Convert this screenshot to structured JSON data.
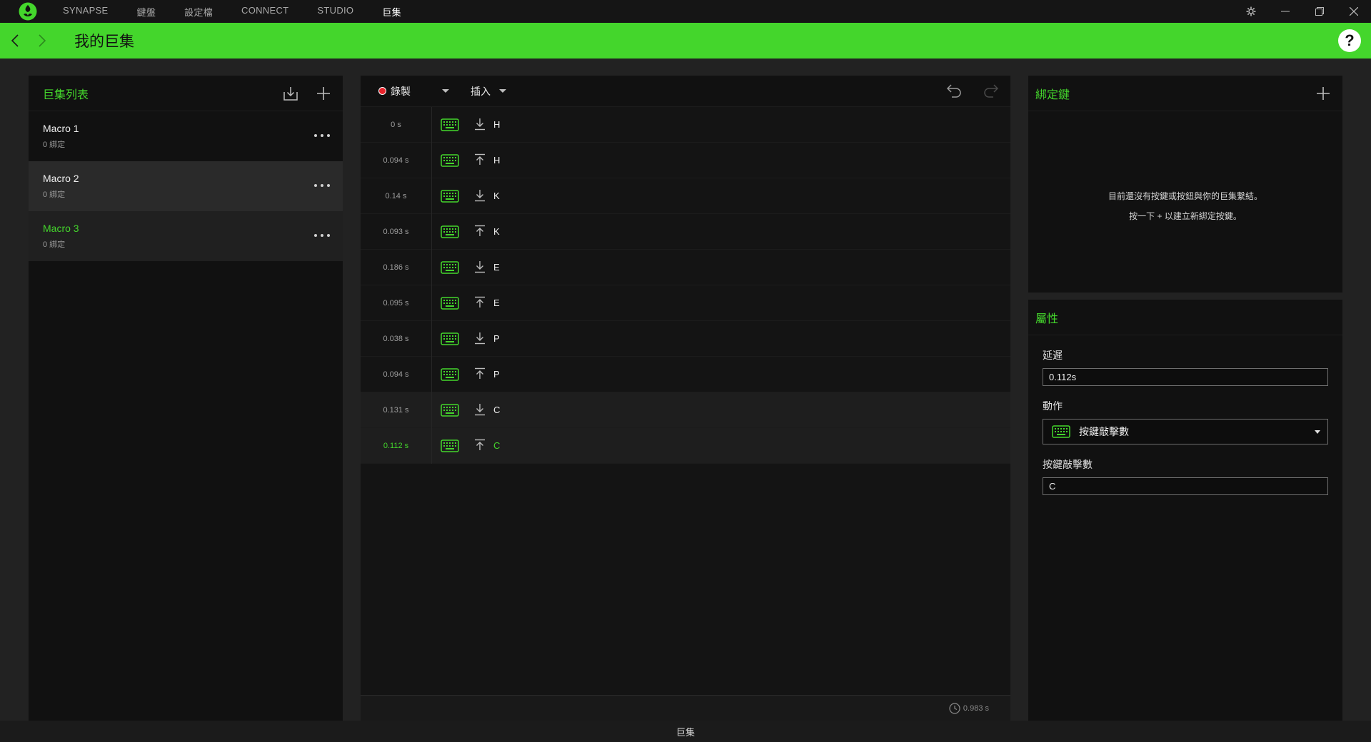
{
  "nav": {
    "items": [
      {
        "label": "SYNAPSE",
        "active": false
      },
      {
        "label": "鍵盤",
        "active": false
      },
      {
        "label": "設定檔",
        "active": false
      },
      {
        "label": "CONNECT",
        "active": false
      },
      {
        "label": "STUDIO",
        "active": false
      },
      {
        "label": "巨集",
        "active": true
      }
    ]
  },
  "header": {
    "title": "我的巨集",
    "help": "?"
  },
  "colors": {
    "accent": "#44d62c",
    "record": "#e8232b",
    "panel": "#111111"
  },
  "macro_list": {
    "title": "巨集列表",
    "items": [
      {
        "name": "Macro 1",
        "sub": "0 綁定",
        "state": "normal"
      },
      {
        "name": "Macro 2",
        "sub": "0 綁定",
        "state": "hovered"
      },
      {
        "name": "Macro 3",
        "sub": "0 綁定",
        "state": "selected"
      }
    ]
  },
  "editor": {
    "record_label": "錄製",
    "insert_label": "插入",
    "events": [
      {
        "time": "0 s",
        "dir": "down",
        "key": "H"
      },
      {
        "time": "0.094 s",
        "dir": "up",
        "key": "H"
      },
      {
        "time": "0.14 s",
        "dir": "down",
        "key": "K"
      },
      {
        "time": "0.093 s",
        "dir": "up",
        "key": "K"
      },
      {
        "time": "0.186 s",
        "dir": "down",
        "key": "E"
      },
      {
        "time": "0.095 s",
        "dir": "up",
        "key": "E"
      },
      {
        "time": "0.038 s",
        "dir": "down",
        "key": "P"
      },
      {
        "time": "0.094 s",
        "dir": "up",
        "key": "P"
      },
      {
        "time": "0.131 s",
        "dir": "down",
        "key": "C"
      },
      {
        "time": "0.112 s",
        "dir": "up",
        "key": "C"
      }
    ],
    "total_duration": "0.983 s"
  },
  "binding": {
    "title": "綁定鍵",
    "empty_line1": "目前還沒有按鍵或按鈕與你的巨集繫結。",
    "empty_line2": "按一下 + 以建立新綁定按鍵。"
  },
  "properties": {
    "title": "屬性",
    "delay_label": "延遲",
    "delay_value": "0.112s",
    "action_label": "動作",
    "action_value": "按鍵敲擊數",
    "keystroke_label": "按鍵敲擊數",
    "keystroke_value": "C"
  },
  "statusbar": {
    "text": "巨集"
  }
}
